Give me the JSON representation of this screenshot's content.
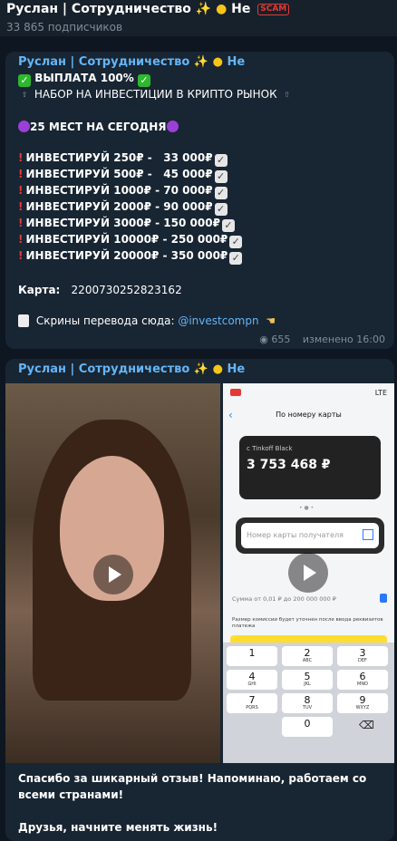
{
  "channel": {
    "title": "Руслан | Сотрудничество",
    "title_suffix": "Не",
    "scam_badge": "SCAM",
    "subscribers": "33 865 подписчиков"
  },
  "post1": {
    "sender": "Руслан | Сотрудничество",
    "sender_suffix": "Не",
    "payout": "ВЫПЛАТА 100%",
    "headline": "НАБОР НА ИНВЕСТИЦИИ В КРИПТО РЫНОК",
    "spots": "25 МЕСТ НА СЕГОДНЯ",
    "offers": [
      "ИНВЕСТИРУЙ 250₽ -   33 000₽",
      "ИНВЕСТИРУЙ 500₽ -   45 000₽",
      "ИНВЕСТИРУЙ 1000₽ - 70 000₽",
      "ИНВЕСТИРУЙ 2000₽ - 90 000₽",
      "ИНВЕСТИРУЙ 3000₽ - 150 000₽",
      "ИНВЕСТИРУЙ 10000₽ - 250 000₽",
      "ИНВЕСТИРУЙ 20000₽ - 350 000₽"
    ],
    "card_label": "Карта:",
    "card_number": "2200730252823162",
    "screens_text": "Скрины перевода сюда:",
    "screens_link": "@investcompn",
    "views": "655",
    "edited": "изменено 16:00"
  },
  "post2": {
    "sender": "Руслан | Сотрудничество",
    "sender_suffix": "Не",
    "phone": {
      "carrier": "LTE",
      "screen_title": "По номеру карты",
      "card_caption": "с Tinkoff Black",
      "balance": "3 753 468 ₽",
      "card_placeholder": "Номер карты получателя",
      "amount_hint": "Сумма от 0,01 ₽ до 200 000 000 ₽",
      "fee_note": "Размер комиссии будет уточнен после ввода реквизитов платежа",
      "keys": [
        {
          "d": "1",
          "l": ""
        },
        {
          "d": "2",
          "l": "ABC"
        },
        {
          "d": "3",
          "l": "DEF"
        },
        {
          "d": "4",
          "l": "GHI"
        },
        {
          "d": "5",
          "l": "JKL"
        },
        {
          "d": "6",
          "l": "MNO"
        },
        {
          "d": "7",
          "l": "PQRS"
        },
        {
          "d": "8",
          "l": "TUV"
        },
        {
          "d": "9",
          "l": "WXYZ"
        },
        {
          "d": "0",
          "l": ""
        }
      ]
    },
    "caption1": "Спасибо за шикарный отзыв! Напоминаю, работаем со",
    "caption2": "всеми странами!",
    "caption3": "Друзья, начните менять жизнь!"
  }
}
